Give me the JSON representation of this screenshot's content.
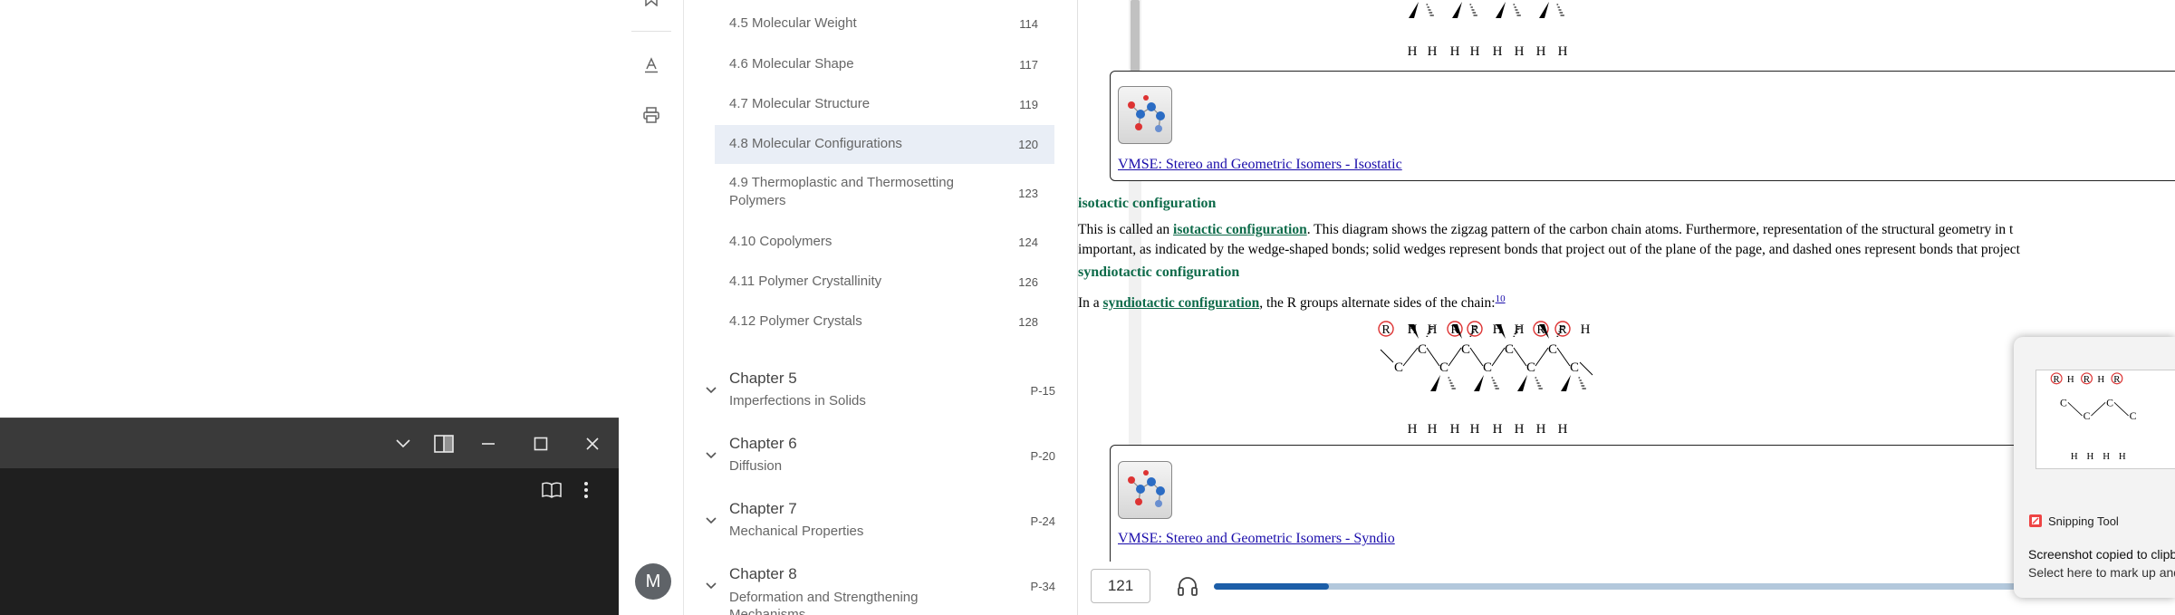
{
  "browser": {
    "window_buttons": [
      "chevron-down-icon",
      "split-view-icon",
      "minimize-icon",
      "maximize-icon",
      "close-icon"
    ],
    "toolbar_icons": [
      "reader-icon",
      "more-icon"
    ]
  },
  "rail": {
    "icons": [
      "bookmark-icon",
      "text-format-icon",
      "print-icon"
    ],
    "avatar_initial": "M"
  },
  "toc": {
    "items": [
      {
        "label": "4.5 Molecular Weight",
        "page": "114",
        "active": false
      },
      {
        "label": "4.6 Molecular Shape",
        "page": "117",
        "active": false
      },
      {
        "label": "4.7 Molecular Structure",
        "page": "119",
        "active": false
      },
      {
        "label": "4.8 Molecular Configurations",
        "page": "120",
        "active": true
      },
      {
        "label": "4.9 Thermoplastic and Thermosetting Polymers",
        "page": "123",
        "active": false
      },
      {
        "label": "4.10 Copolymers",
        "page": "124",
        "active": false
      },
      {
        "label": "4.11 Polymer Crystallinity",
        "page": "126",
        "active": false
      },
      {
        "label": "4.12 Polymer Crystals",
        "page": "128",
        "active": false
      }
    ],
    "chapters": [
      {
        "title": "Chapter 5",
        "subtitle": "Imperfections in Solids",
        "page": "P-15"
      },
      {
        "title": "Chapter 6",
        "subtitle": "Diffusion",
        "page": "P-20"
      },
      {
        "title": "Chapter 7",
        "subtitle": "Mechanical Properties",
        "page": "P-24"
      },
      {
        "title": "Chapter 8",
        "subtitle": "Deformation and Strengthening Mechanisms",
        "page": "P-34"
      }
    ]
  },
  "content": {
    "vmse_link_1": "VMSE: Stereo and Geometric Isomers - Isostatic",
    "heading_isotactic": "isotactic configuration",
    "iso_para_1_before": "This is called an ",
    "iso_para_1_term": "isotactic configuration",
    "iso_para_1_after": ". This diagram shows the zigzag pattern of the carbon chain atoms. Furthermore, representation of the structural geometry in t",
    "iso_para_2": "important, as indicated by the wedge-shaped bonds; solid wedges represent bonds that project out of the plane of the page, and dashed ones represent bonds that project",
    "heading_syndiotactic": "syndiotactic configuration",
    "syn_para_before": "In a ",
    "syn_para_term": "syndiotactic configuration",
    "syn_para_after": ", the R groups alternate sides of the chain:",
    "syn_footnote": "10",
    "vmse_link_2": "VMSE: Stereo and Geometric Isomers - Syndio",
    "atom_C": "C",
    "atom_H": "H",
    "atom_R": "R"
  },
  "bottom_bar": {
    "page_number": "121",
    "audio_icon": "headphones-icon",
    "progress_fraction": 0.12
  },
  "toast": {
    "app_name": "Snipping Tool",
    "title": "Screenshot copied to clipb",
    "body": "Select here to mark up and"
  }
}
